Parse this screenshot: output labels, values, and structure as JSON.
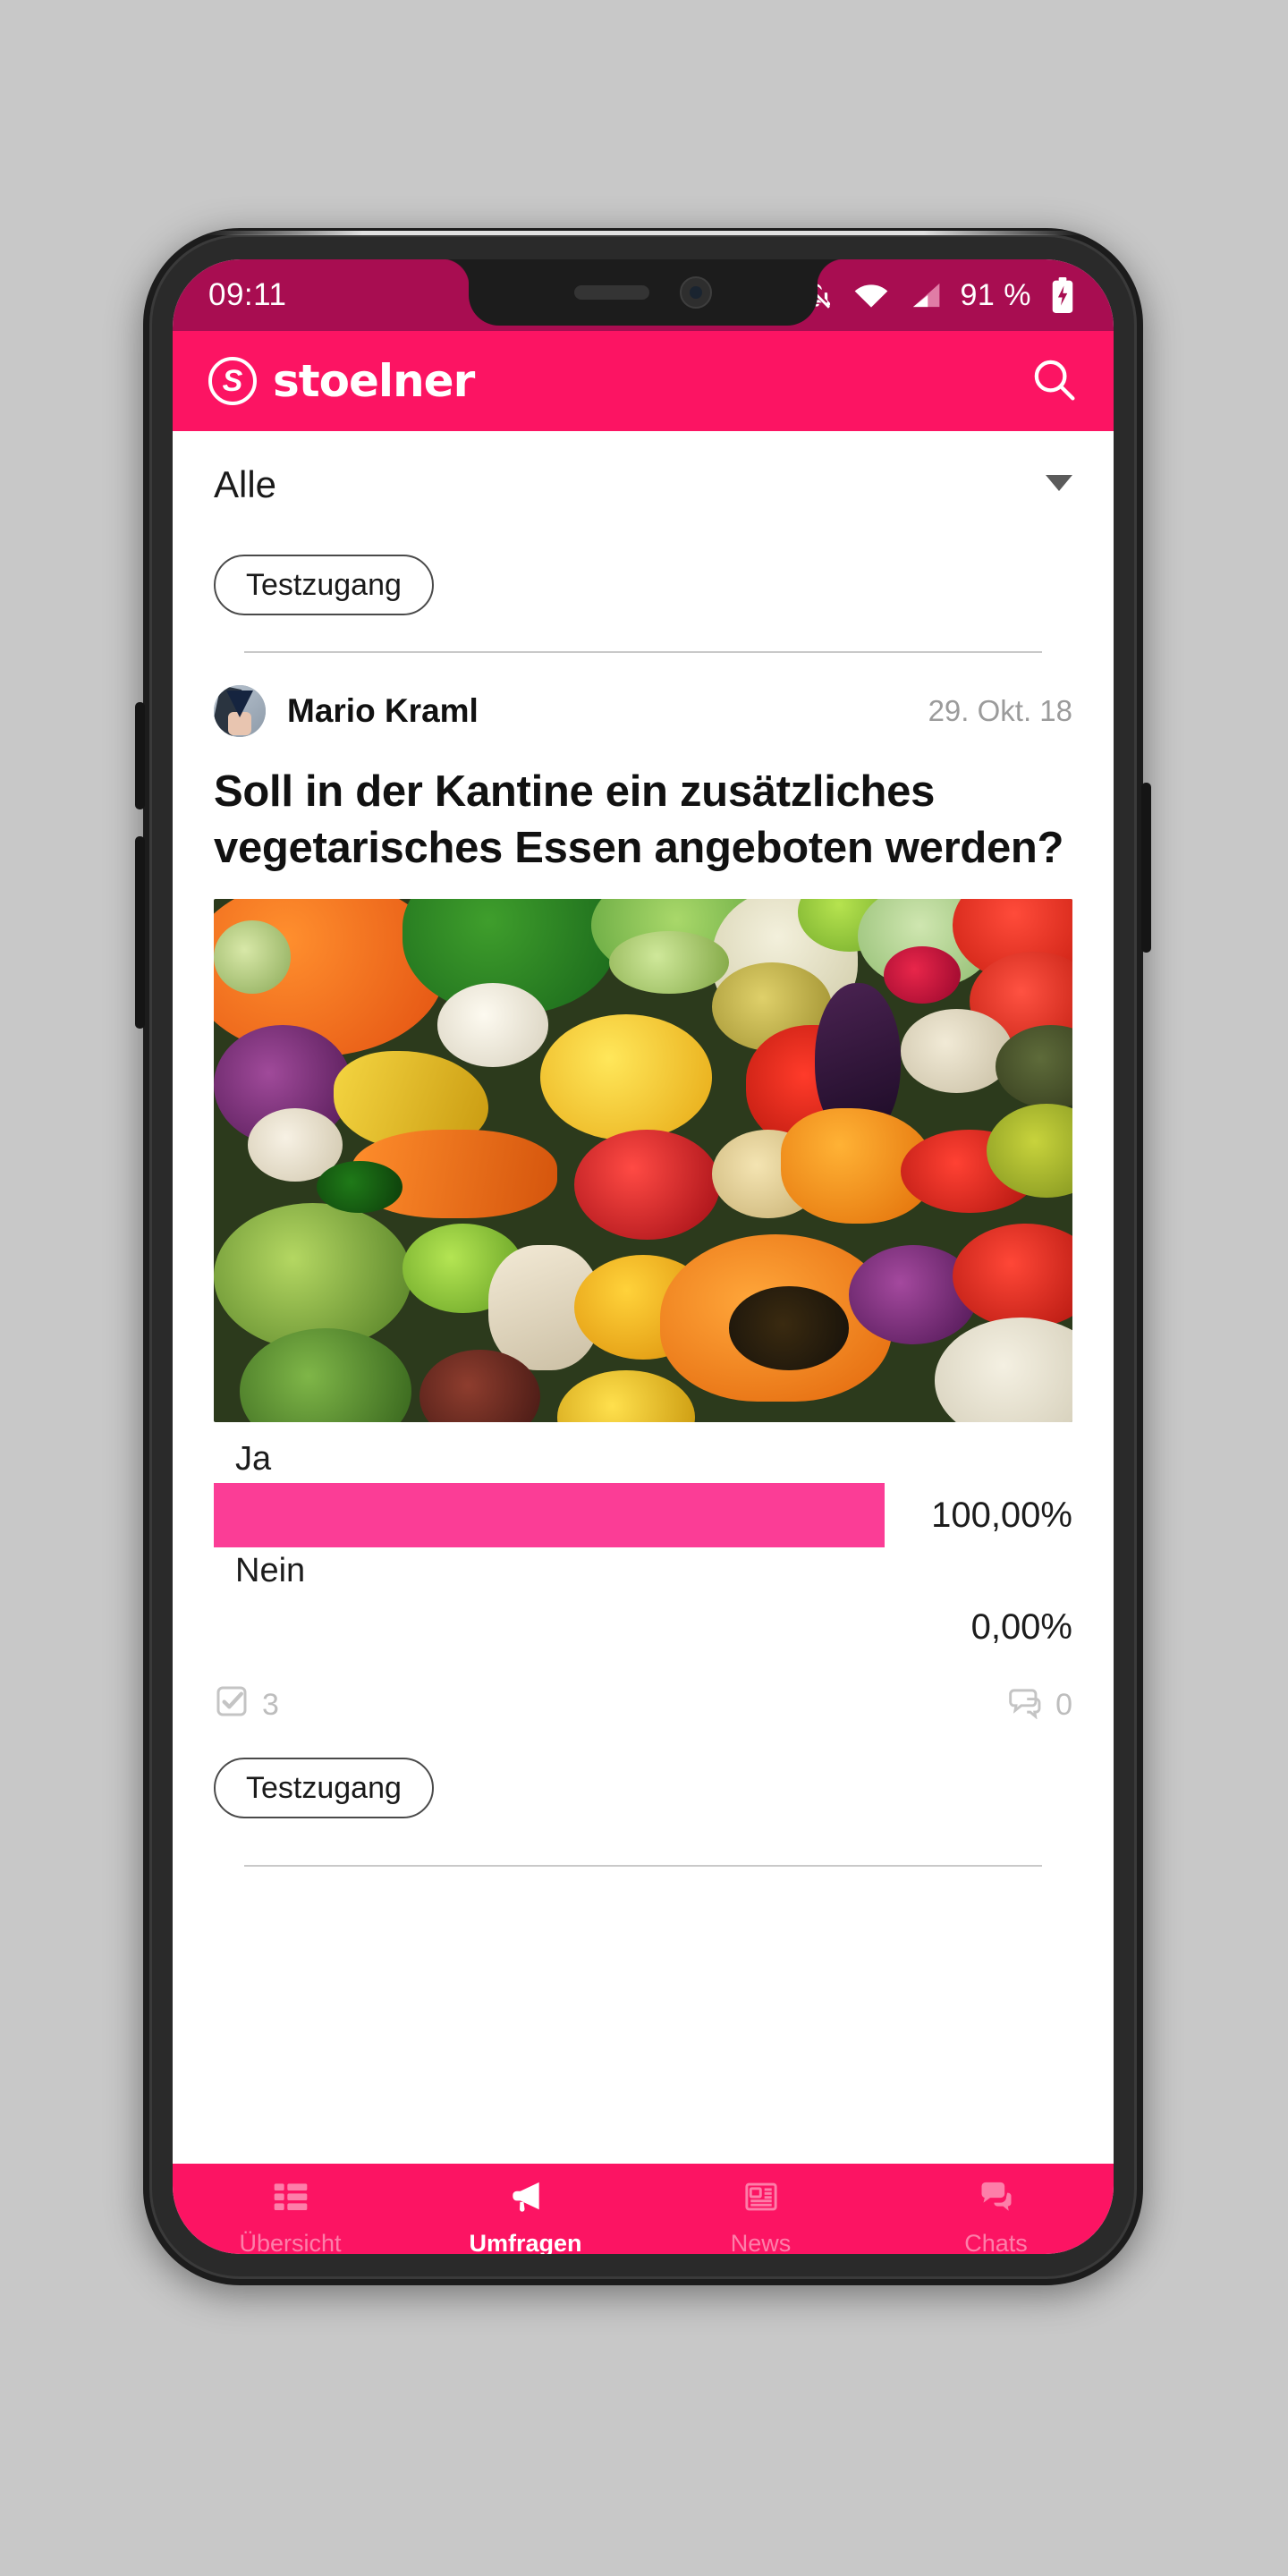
{
  "status_bar": {
    "clock": "09:11",
    "battery_percent": "91 %",
    "icons": [
      "bell-off-icon",
      "wifi-icon",
      "cellular-signal-icon",
      "battery-charging-icon"
    ]
  },
  "app_bar": {
    "logo_text": "stoelner",
    "logo_mark": "S",
    "search_icon": "search-icon"
  },
  "filter": {
    "selected": "Alle",
    "caret_icon": "chevron-down-icon"
  },
  "chips": {
    "top": "Testzugang",
    "bottom": "Testzugang"
  },
  "post": {
    "author": "Mario Kraml",
    "date": "29. Okt. 18",
    "title": "Soll in der Kantine ein zusätzliches vegetarisches Essen angeboten werden?",
    "image_alt": "fruits-and-vegetables-photo",
    "votes_count": "3",
    "comments_count": "0",
    "votes_icon": "checkbox-checked-icon",
    "comments_icon": "comment-bubble-icon"
  },
  "chart_data": {
    "type": "bar",
    "title": "Soll in der Kantine ein zusätzliches vegetarisches Essen angeboten werden?",
    "categories": [
      "Ja",
      "Nein"
    ],
    "values": [
      100.0,
      0.0
    ],
    "value_labels": [
      "100,00%",
      "0,00%"
    ],
    "ylabel": "",
    "xlabel": "",
    "xlim": [
      0,
      100
    ],
    "grid": false,
    "legend": "none",
    "bar_color": "#fb3d96",
    "total_votes": 3
  },
  "bottom_nav": {
    "items": [
      {
        "label": "Übersicht",
        "icon": "list-grid-icon",
        "active": false
      },
      {
        "label": "Umfragen",
        "icon": "megaphone-icon",
        "active": true
      },
      {
        "label": "News",
        "icon": "newspaper-icon",
        "active": false
      },
      {
        "label": "Chats",
        "icon": "chat-bubbles-icon",
        "active": false
      }
    ]
  },
  "system_nav": {
    "recents": "square-recents-icon",
    "home": "circle-home-icon",
    "back": "triangle-back-icon"
  },
  "colors": {
    "brand_pink": "#fc1463",
    "status_bar": "#a80d51",
    "bar_fill": "#fb3d96",
    "page_background": "#c8c8c8"
  }
}
